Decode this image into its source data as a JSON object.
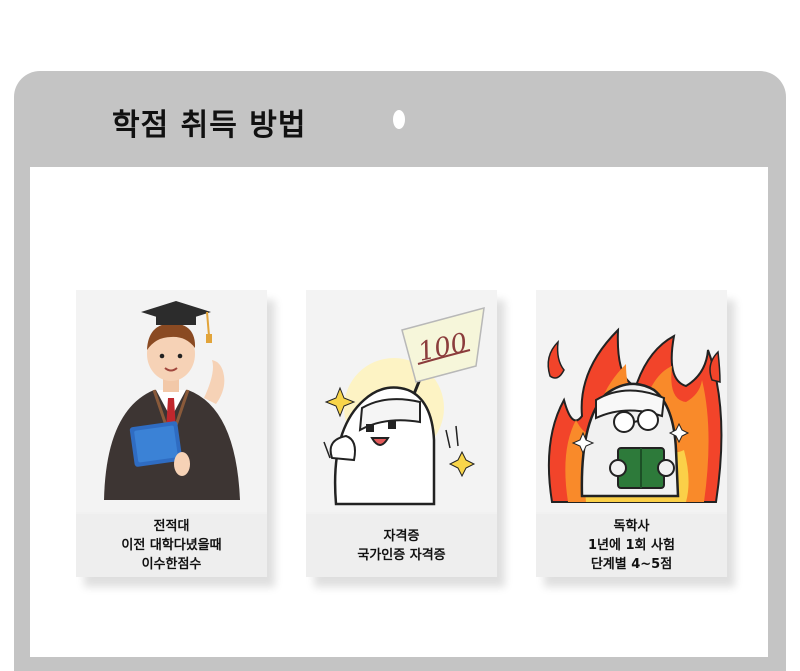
{
  "header": {
    "title": "학점 취득 방법"
  },
  "cards": [
    {
      "lines": [
        "전적대",
        "이전 대학다녔을때",
        "이수한점수"
      ],
      "icon": "graduate-illustration"
    },
    {
      "lines": [
        "자격증",
        "국가인증 자격증"
      ],
      "icon": "certificate-100-illustration",
      "sign_text": "100"
    },
    {
      "lines": [
        "독학사",
        "1년에 1회 사험",
        "단계별 4~5점"
      ],
      "icon": "studying-fire-illustration"
    }
  ]
}
